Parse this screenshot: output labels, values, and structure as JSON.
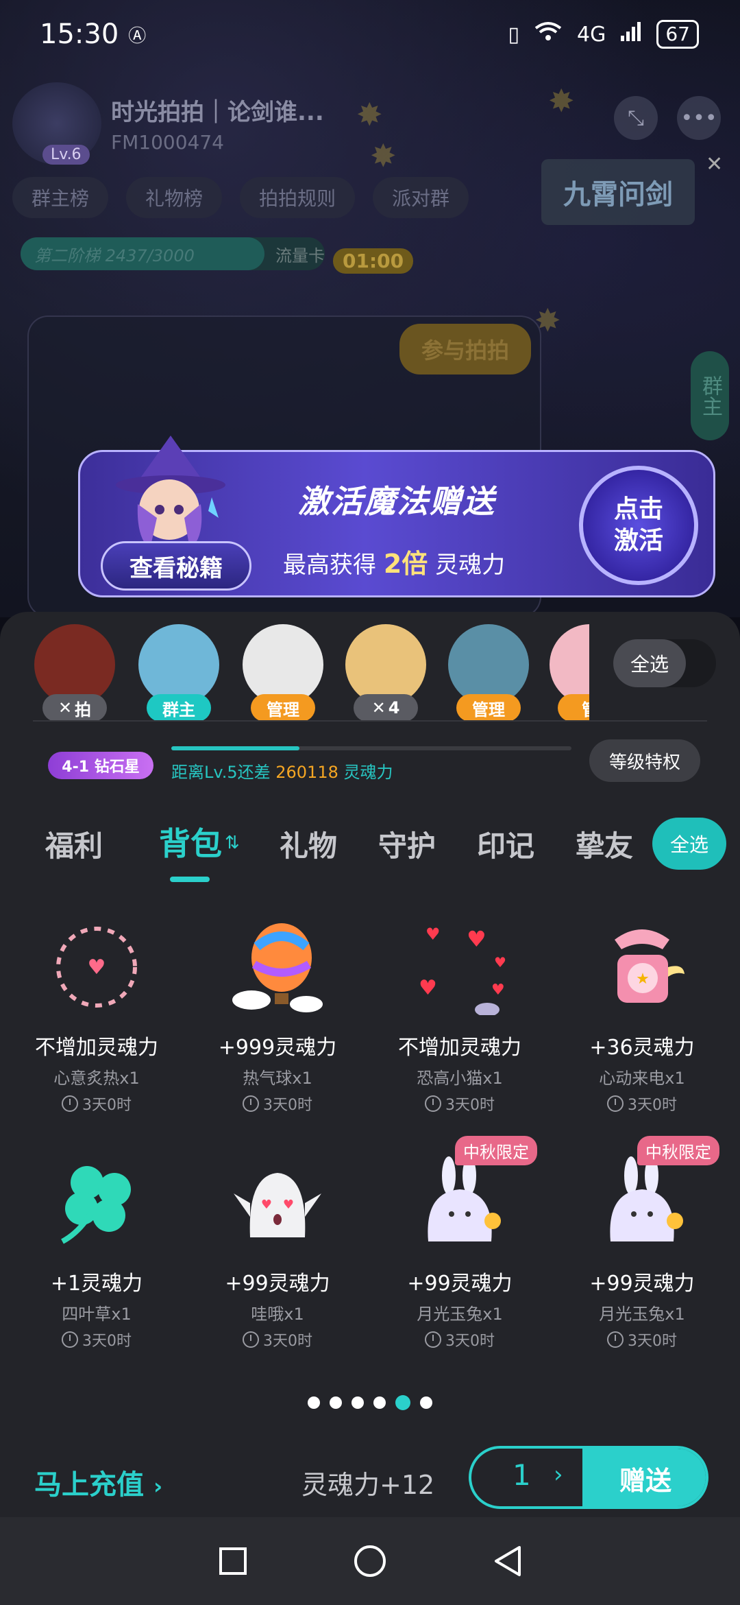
{
  "status_bar": {
    "time": "15:30",
    "network": "4G",
    "battery": "67"
  },
  "room": {
    "title": "时光拍拍｜论剑谁...",
    "id": "FM1000474",
    "level": "Lv.6",
    "tabs": [
      "群主榜",
      "礼物榜",
      "拍拍规则",
      "派对群"
    ],
    "stage_progress": "第二阶梯 2437/3000",
    "traffic_card": "流量卡",
    "timer": "01:00",
    "join_button": "参与拍拍",
    "game_card": "九霄问剑",
    "side_label": "群主"
  },
  "banner": {
    "title": "激活魔法赠送",
    "subtitle_prefix": "最高获得",
    "multiplier": "2倍",
    "subtitle_suffix": "灵魂力",
    "secret_button": "查看秘籍",
    "activate_button": "点击激活"
  },
  "mic_users": [
    {
      "tag": "拍",
      "tag_color": "grey",
      "face_color": "#7a2a22"
    },
    {
      "tag": "群主",
      "tag_color": "teal",
      "face_color": "#6fb7d8"
    },
    {
      "tag": "管理",
      "tag_color": "orange",
      "face_color": "#e8e8e8"
    },
    {
      "tag": "4",
      "tag_color": "grey",
      "face_color": "#e9c27a"
    },
    {
      "tag": "管理",
      "tag_color": "orange",
      "face_color": "#5a8fa6"
    },
    {
      "tag": "管",
      "tag_color": "orange",
      "face_color": "#f2b9c4"
    }
  ],
  "select_all_top": "全选",
  "level": {
    "badge": "4-1 钻石星",
    "text_prefix": "距离Lv.5还差",
    "remaining": "260118",
    "text_suffix": "灵魂力",
    "progress": 0.32,
    "perk_button": "等级特权"
  },
  "tabs": [
    {
      "label": "福利",
      "active": false
    },
    {
      "label": "背包",
      "active": true
    },
    {
      "label": "礼物",
      "active": false
    },
    {
      "label": "守护",
      "active": false
    },
    {
      "label": "印记",
      "active": false
    },
    {
      "label": "挚友",
      "active": false
    }
  ],
  "select_all_tab": "全选",
  "gifts": [
    {
      "power": "不增加灵魂力",
      "name": "心意炙热x1",
      "time": "3天0时",
      "icon": "heart-ring-icon",
      "limited": ""
    },
    {
      "power": "+999灵魂力",
      "name": "热气球x1",
      "time": "3天0时",
      "icon": "hot-air-balloon-icon",
      "limited": ""
    },
    {
      "power": "不增加灵魂力",
      "name": "恐高小猫x1",
      "time": "3天0时",
      "icon": "hearts-cat-icon",
      "limited": ""
    },
    {
      "power": "+36灵魂力",
      "name": "心动来电x1",
      "time": "3天0时",
      "icon": "telephone-icon",
      "limited": ""
    },
    {
      "power": "+1灵魂力",
      "name": "四叶草x1",
      "time": "3天0时",
      "icon": "clover-icon",
      "limited": ""
    },
    {
      "power": "+99灵魂力",
      "name": "哇哦x1",
      "time": "3天0时",
      "icon": "ghost-icon",
      "limited": ""
    },
    {
      "power": "+99灵魂力",
      "name": "月光玉兔x1",
      "time": "3天0时",
      "icon": "moon-rabbit-icon",
      "limited": "中秋限定"
    },
    {
      "power": "+99灵魂力",
      "name": "月光玉兔x1",
      "time": "3天0时",
      "icon": "moon-rabbit-icon",
      "limited": "中秋限定"
    }
  ],
  "pagination": {
    "count": 6,
    "active": 4
  },
  "footer": {
    "recharge": "马上充值",
    "soul_total": "灵魂力+12",
    "quantity": "1",
    "send": "赠送"
  },
  "colors": {
    "accent": "#2bd0cb",
    "sheet_bg": "#232429",
    "orange_tag": "#f49a20"
  }
}
